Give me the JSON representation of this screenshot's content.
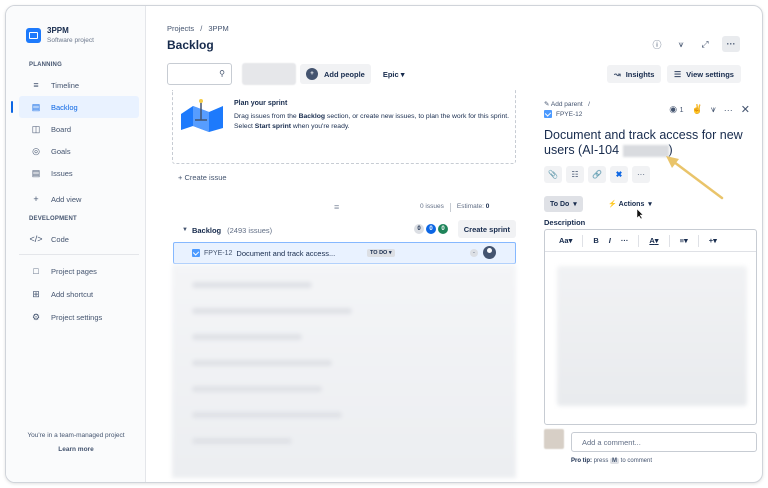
{
  "project": {
    "name": "3PPM",
    "type": "Software project"
  },
  "sidebar": {
    "planning_header": "PLANNING",
    "planning_items": [
      {
        "label": "Timeline",
        "icon": "timeline-icon"
      },
      {
        "label": "Backlog",
        "icon": "backlog-icon",
        "active": true
      },
      {
        "label": "Board",
        "icon": "board-icon"
      },
      {
        "label": "Goals",
        "icon": "goals-icon"
      },
      {
        "label": "Issues",
        "icon": "issues-icon"
      },
      {
        "label": "Add view",
        "icon": "plus-icon"
      }
    ],
    "development_header": "DEVELOPMENT",
    "development_items": [
      {
        "label": "Code",
        "icon": "code-icon"
      }
    ],
    "other_items": [
      {
        "label": "Project pages",
        "icon": "pages-icon"
      },
      {
        "label": "Add shortcut",
        "icon": "add-shortcut-icon"
      },
      {
        "label": "Project settings",
        "icon": "settings-icon"
      }
    ],
    "team_note": "You're in a team-managed project",
    "learn_more": "Learn more"
  },
  "header": {
    "breadcrumb": [
      "Projects",
      "/",
      "3PPM"
    ],
    "title": "Backlog"
  },
  "toolbar": {
    "search_placeholder": "",
    "add_people": "Add people",
    "epic": "Epic",
    "insights": "Insights",
    "view_settings": "View settings"
  },
  "sprint": {
    "plan_title": "Plan your sprint",
    "plan_text_1": "Drag issues from the ",
    "plan_text_bold1": "Backlog",
    "plan_text_2": " section, or create new issues, to plan the work for this sprint. Select ",
    "plan_text_bold2": "Start sprint",
    "plan_text_3": " when you're ready.",
    "create_issue": "+ Create issue",
    "issue_count": "0 issues",
    "estimate_label": "Estimate:",
    "estimate_value": "0"
  },
  "backlog": {
    "label": "Backlog",
    "count": "(2493 issues)",
    "pills": [
      "0",
      "0",
      "0"
    ],
    "create_sprint": "Create sprint",
    "issue": {
      "key": "FPYE-12",
      "summary": "Document and track access...",
      "status": "TO DO",
      "estimate": "-"
    }
  },
  "detail": {
    "add_parent": "Add parent",
    "slash": "/",
    "key": "FPYE-12",
    "watchers": "1",
    "title_line1": "Document and track access for new",
    "title_line2": "users (AI-104",
    "title_end": ")",
    "status": "To Do",
    "actions": "Actions",
    "description_label": "Description",
    "editor_tools": [
      "Aa",
      "B",
      "I",
      "···",
      "A",
      "≡",
      "+"
    ],
    "comment_placeholder": "Add a comment...",
    "protip_label": "Pro tip:",
    "protip_text": " press ",
    "protip_key": "M",
    "protip_end": " to comment"
  },
  "colors": {
    "accent": "#0c66e4",
    "annotation_arrow": "#e9c46a"
  }
}
